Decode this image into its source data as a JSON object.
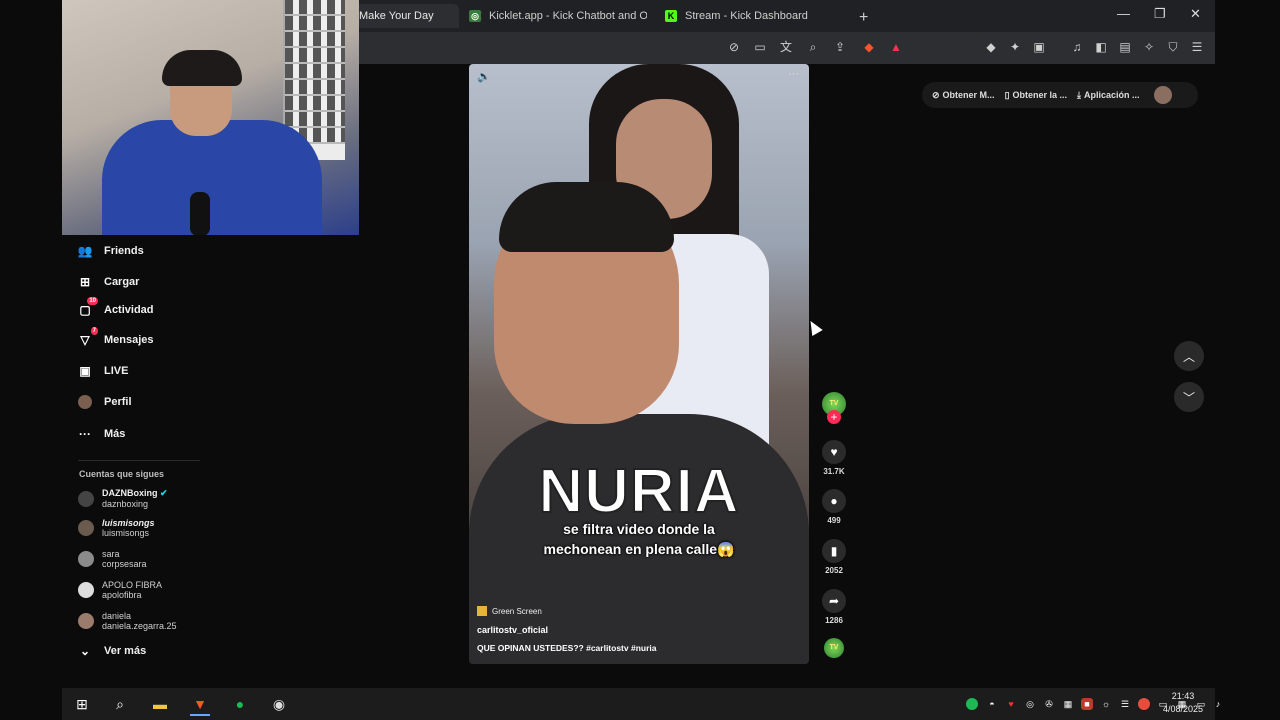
{
  "browser": {
    "tabs": [
      {
        "label": "Make Your Day",
        "active": true
      },
      {
        "label": "Kicklet.app - Kick Chatbot and Overla"
      },
      {
        "label": "Stream - Kick Dashboard"
      }
    ],
    "new_tab": "+",
    "window": {
      "minimize": "—",
      "restore": "❐",
      "close": "✕"
    }
  },
  "sidebar": {
    "items": [
      {
        "label": "Friends",
        "icon": "friends-icon"
      },
      {
        "label": "Cargar",
        "icon": "upload-icon"
      },
      {
        "label": "Actividad",
        "icon": "activity-icon",
        "badge": "10"
      },
      {
        "label": "Mensajes",
        "icon": "messages-icon",
        "badge": "7"
      },
      {
        "label": "LIVE",
        "icon": "live-icon"
      },
      {
        "label": "Perfil",
        "icon": "profile-avatar"
      },
      {
        "label": "Más",
        "icon": "more-icon"
      }
    ],
    "following_title": "Cuentas que sigues",
    "following": [
      {
        "name": "DAZNBoxing",
        "handle": "daznboxing",
        "verified": true
      },
      {
        "name": "luismisongs",
        "handle": "luismisongs"
      },
      {
        "name": "sara",
        "handle": "corpsesara"
      },
      {
        "name": "APOLO FIBRA",
        "handle": "apolofibra"
      },
      {
        "name": "daniela",
        "handle": "daniela.zegarra.25"
      }
    ],
    "see_more": "Ver más"
  },
  "video": {
    "overlay_title": "NURIA",
    "overlay_line1": "se filtra video donde la",
    "overlay_line2": "mechonean en plena calle😱",
    "effect": "Green Screen",
    "author": "carlitostv_oficial",
    "caption": "QUE OPINAN USTEDES?? #carlitostv  #nuria"
  },
  "actions": {
    "likes": "31.7K",
    "comments": "499",
    "saves": "2052",
    "shares": "1286"
  },
  "topbar": {
    "btn1": "Obtener M...",
    "btn2": "Obtener la ...",
    "btn3": "Aplicación ..."
  },
  "taskbar": {
    "time": "21:43",
    "date": "4/08/2025"
  },
  "colors": {
    "accent": "#fe2c55",
    "kick_green": "#53fc18",
    "brave_orange": "#fb542b"
  }
}
